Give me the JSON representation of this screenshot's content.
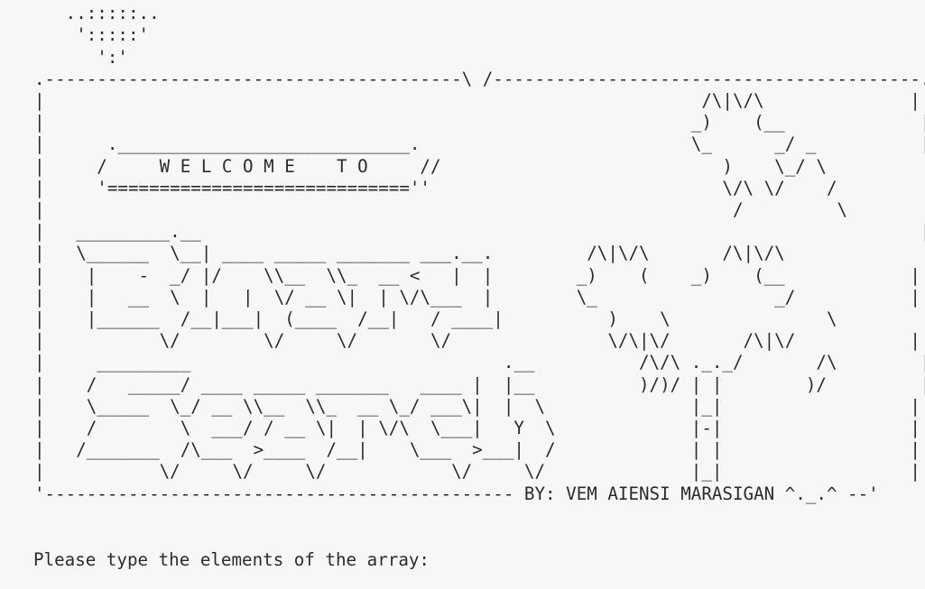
{
  "terminal": {
    "banner_art": "     .:.:.\n   ..:::::..\n    ':::::'\n      ':'\n.----------------------------------------\\ /-----------------------------------------.\n|                                                               /\\|\\/\\              |\n|                                                              _)    (__             |\n|      .____________________________.                          \\_      _/ _          |\n|     /     W E L C O M E    T O     //                           )    \\_/ \\          |\n|     '=============================''                            \\/\\ \\/    /         |\n|                                                                  /         \\        |\n|   _________.__                                                                     |\n|   \\______  \\__| ____ _____ _______ ___.__.         /\\|\\/\\       /\\|\\/\\              |\n|    |    -  _/ |/    \\\\__  \\\\_  __ <   |  |        _)    (    _)    (__            |\n|    |   __  \\  |   |  \\/ __ \\|  | \\/\\___  |        \\_                 _/           |\n|    |______  /__|___|  (____  /__|   / ____|          )    \\               \\          |\n|           \\/        \\/     \\/       \\/               \\/\\|\\/       /\\|\\/           |\n|     _________                              .__          /\\/\\ ._._/       /\\        |\n|    /   _____/ ____ _____ _______   ____ |  |__          )/)/ | |        )/         |\n|    \\_____  \\_/ __ \\\\__  \\\\_  __ \\_/ ___\\|  |  \\              |_|                  |\n|    /        \\  ___/ / __ \\|  | \\/\\  \\___|   Y  \\             |-|                  |\n|   /_______  /\\___  >____  /__|    \\___  >___|  /             | |                  |\n|           \\/     \\/     \\/            \\/     \\/              |_|                  |\n'--------------------------------------------- BY: VEM AIENSI MARASIGAN ^._.^ --'",
    "prompt_text": "Please type the elements of the array:",
    "input_value": ""
  }
}
